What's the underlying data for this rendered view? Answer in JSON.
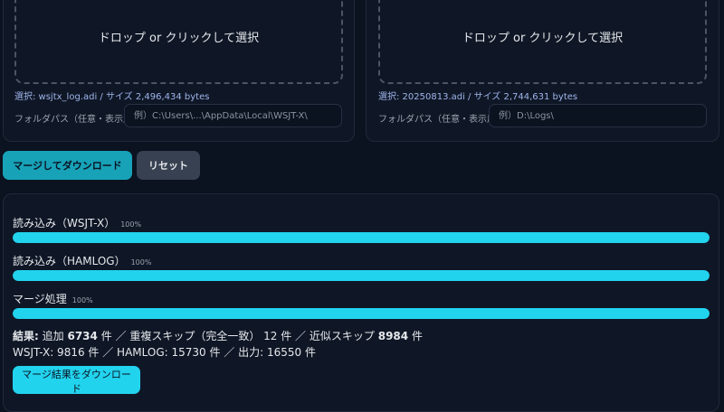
{
  "left_panel": {
    "drop_label": "ドロップ or クリックして選択",
    "selected": "選択: wsjtx_log.adi / サイズ 2,496,434 bytes",
    "folder_label": "フォルダパス（任意・表示用）",
    "folder_placeholder": "例）C:\\Users\\...\\AppData\\Local\\WSJT-X\\"
  },
  "right_panel": {
    "drop_label": "ドロップ or クリックして選択",
    "selected": "選択: 20250813.adi / サイズ 2,744,631 bytes",
    "folder_label": "フォルダパス（任意・表示用）",
    "folder_placeholder": "例）D:\\Logs\\"
  },
  "actions": {
    "merge_label": "マージしてダウンロード",
    "reset_label": "リセット"
  },
  "progress": [
    {
      "label": "読み込み（WSJT-X）",
      "pct_text": "100%",
      "value": 100
    },
    {
      "label": "読み込み（HAMLOG）",
      "pct_text": "100%",
      "value": 100
    },
    {
      "label": "マージ処理",
      "pct_text": "100%",
      "value": 100
    }
  ],
  "result": {
    "prefix": "結果:",
    "added_label": "追加",
    "added_count": "6734",
    "added_unit": "件 ／ 重複スキップ（完全一致） 12 件 ／ 近似スキップ",
    "approx_count": "8984",
    "approx_unit": "件",
    "line2": "WSJT-X: 9816 件 ／ HAMLOG: 15730 件 ／ 出力: 16550 件"
  },
  "download_result_label": "マージ結果をダウンロード",
  "colors": {
    "accent": "#22d3ee",
    "accent_dark": "#17a2b8",
    "background": "#0b1220"
  }
}
